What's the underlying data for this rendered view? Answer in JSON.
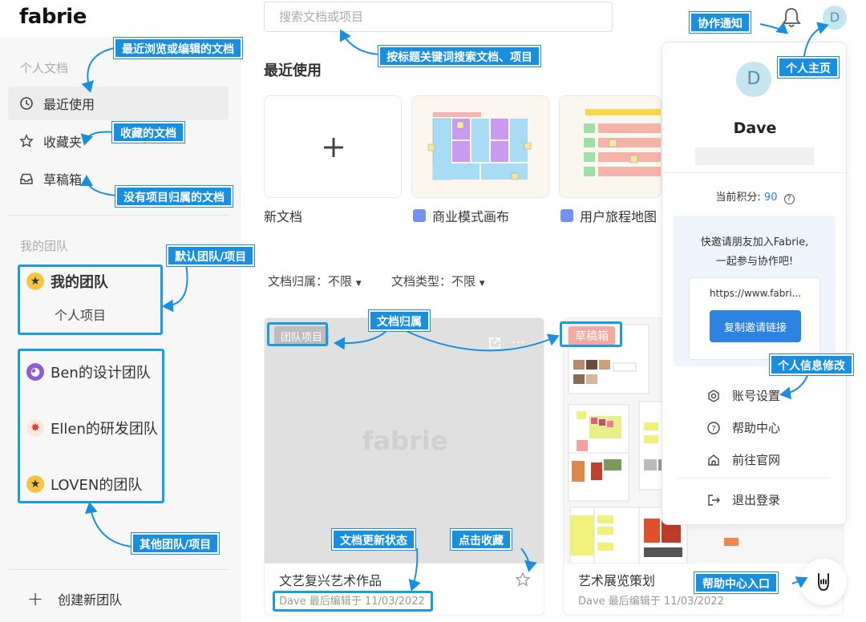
{
  "app": {
    "logo": "fabrie"
  },
  "search": {
    "placeholder": "搜索文档或项目"
  },
  "header": {
    "avatar_initial": "D"
  },
  "sidebar": {
    "personal_section": "个人文档",
    "items": [
      {
        "label": "最近使用",
        "icon": "clock-icon"
      },
      {
        "label": "收藏夹",
        "icon": "star-icon"
      },
      {
        "label": "草稿箱",
        "icon": "inbox-icon"
      }
    ],
    "team_section": "我的团队",
    "teams": [
      {
        "label": "我的团队",
        "emoji": "star-struck-emoji"
      },
      {
        "label": "Ben的设计团队",
        "emoji": "devil-emoji"
      },
      {
        "label": "Ellen的研发团队",
        "emoji": "explosion-emoji"
      },
      {
        "label": "LOVEN的团队",
        "emoji": "star-struck-emoji"
      }
    ],
    "sub_project": "个人项目",
    "create_team": "创建新团队"
  },
  "main": {
    "recent_title": "最近使用",
    "templates": [
      {
        "label": "新文档"
      },
      {
        "label": "商业模式画布"
      },
      {
        "label": "用户旅程地图"
      }
    ],
    "filters": [
      {
        "label": "文档归属：不限"
      },
      {
        "label": "文档类型：不限"
      }
    ],
    "docs": [
      {
        "badge": "团队项目",
        "title": "文艺复兴艺术作品",
        "meta": "Dave  最后编辑于 11/03/2022",
        "watermark": "fabrie"
      },
      {
        "badge": "草稿箱",
        "title": "艺术展览策划",
        "meta": "Dave  最后编辑于 11/03/2022"
      }
    ]
  },
  "profile": {
    "avatar_initial": "D",
    "name": "Dave",
    "points_label": "当前积分:",
    "points_value": "90",
    "invite_line1": "快邀请朋友加入Fabrie,",
    "invite_line2": "一起参与协作吧!",
    "invite_url": "https://www.fabri...",
    "copy_button": "复制邀请链接",
    "menu": [
      {
        "label": "账号设置",
        "icon": "settings-icon"
      },
      {
        "label": "帮助中心",
        "icon": "help-circle-icon"
      },
      {
        "label": "前往官网",
        "icon": "home-icon"
      },
      {
        "label": "退出登录",
        "icon": "logout-icon"
      }
    ]
  },
  "annotations": {
    "recent_docs": "最近浏览或编辑的文档",
    "search_hint": "按标题关键词搜索文档、项目",
    "notifications": "协作通知",
    "profile_page": "个人主页",
    "favorites": "收藏的文档",
    "no_project": "没有项目归属的文档",
    "default_team": "默认团队/项目",
    "doc_owner": "文档归属",
    "profile_edit": "个人信息修改",
    "other_teams": "其他团队/项目",
    "doc_status": "文档更新状态",
    "click_fav": "点击收藏",
    "help_entry": "帮助中心入口"
  },
  "colors": {
    "accent": "#1a8fe0",
    "button": "#2c83e0",
    "avatar_bg": "#c5e6f0"
  }
}
